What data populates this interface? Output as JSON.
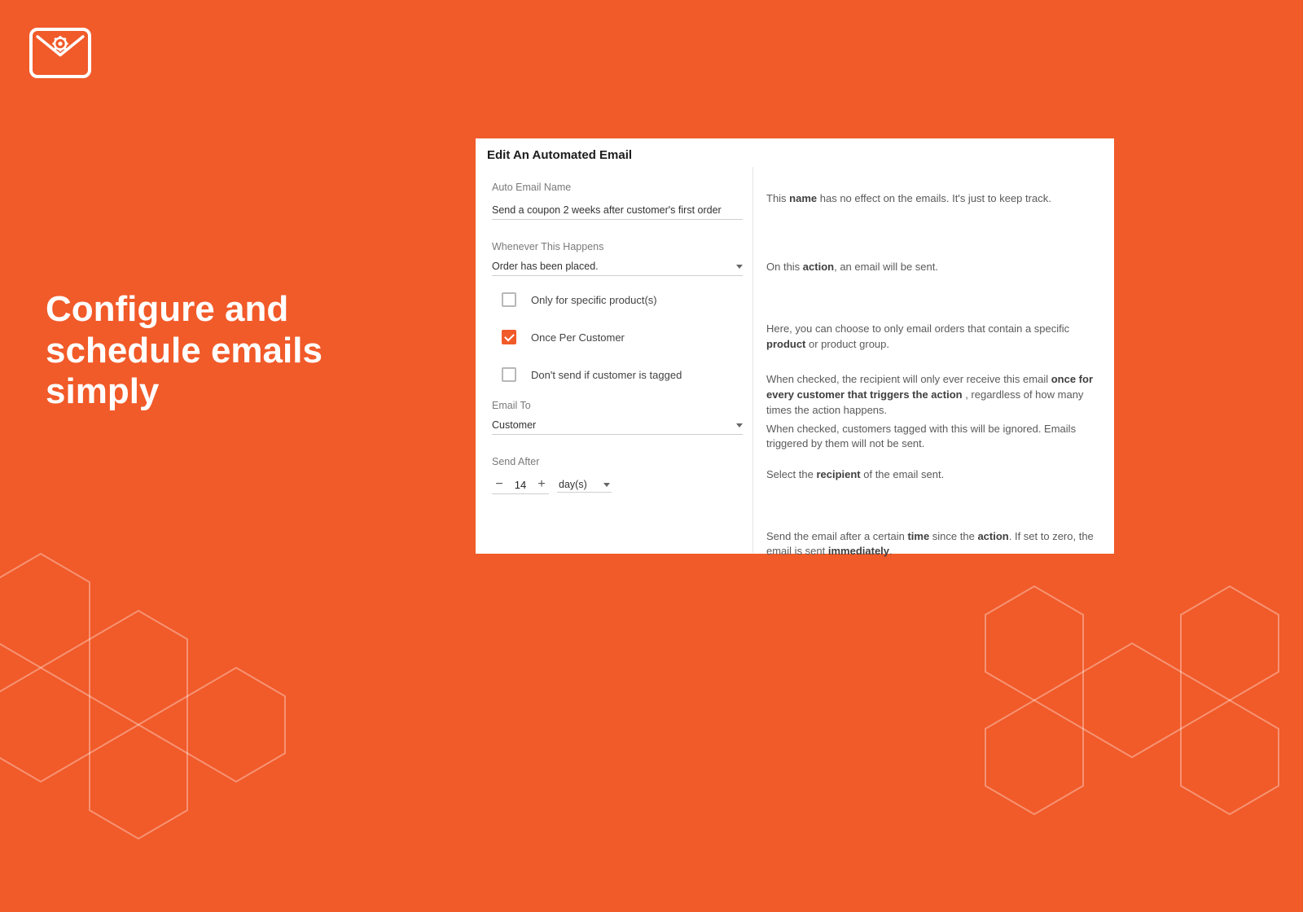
{
  "headline": "Configure and schedule emails simply",
  "dialog": {
    "title": "Edit An Automated Email",
    "fields": {
      "name_label": "Auto Email Name",
      "name_value": "Send a coupon 2 weeks after customer's first order",
      "trigger_label": "Whenever This Happens",
      "trigger_value": "Order has been placed.",
      "opt_specific_product": "Only for specific product(s)",
      "opt_once_per_customer": "Once Per Customer",
      "opt_dont_send_tagged": "Don't send if customer is tagged",
      "emailto_label": "Email To",
      "emailto_value": "Customer",
      "sendafter_label": "Send After",
      "sendafter_value": "14",
      "sendafter_unit": "day(s)"
    },
    "help": {
      "name_pre": "This ",
      "name_b": "name",
      "name_post": " has no effect on the emails. It's just to keep track.",
      "trigger_pre": "On this ",
      "trigger_b": "action",
      "trigger_post": ", an email will be sent.",
      "product_pre": "Here, you can choose to only email orders that contain a specific ",
      "product_b": "product",
      "product_post": " or product group.",
      "once_pre": "When checked, the recipient will only ever receive this email ",
      "once_b": "once for every customer that triggers the action",
      "once_post": " , regardless of how many times the action happens.",
      "tag": "When checked, customers tagged with this will be ignored. Emails triggered by them will not be sent.",
      "recip_pre": "Select the ",
      "recip_b": "recipient",
      "recip_post": " of the email sent.",
      "sa_pre": "Send the email after a certain ",
      "sa_b1": "time",
      "sa_mid": " since the ",
      "sa_b2": "action",
      "sa_post1": ". If set to zero, the email is sent ",
      "sa_b3": "immediately",
      "sa_post2": "."
    }
  }
}
